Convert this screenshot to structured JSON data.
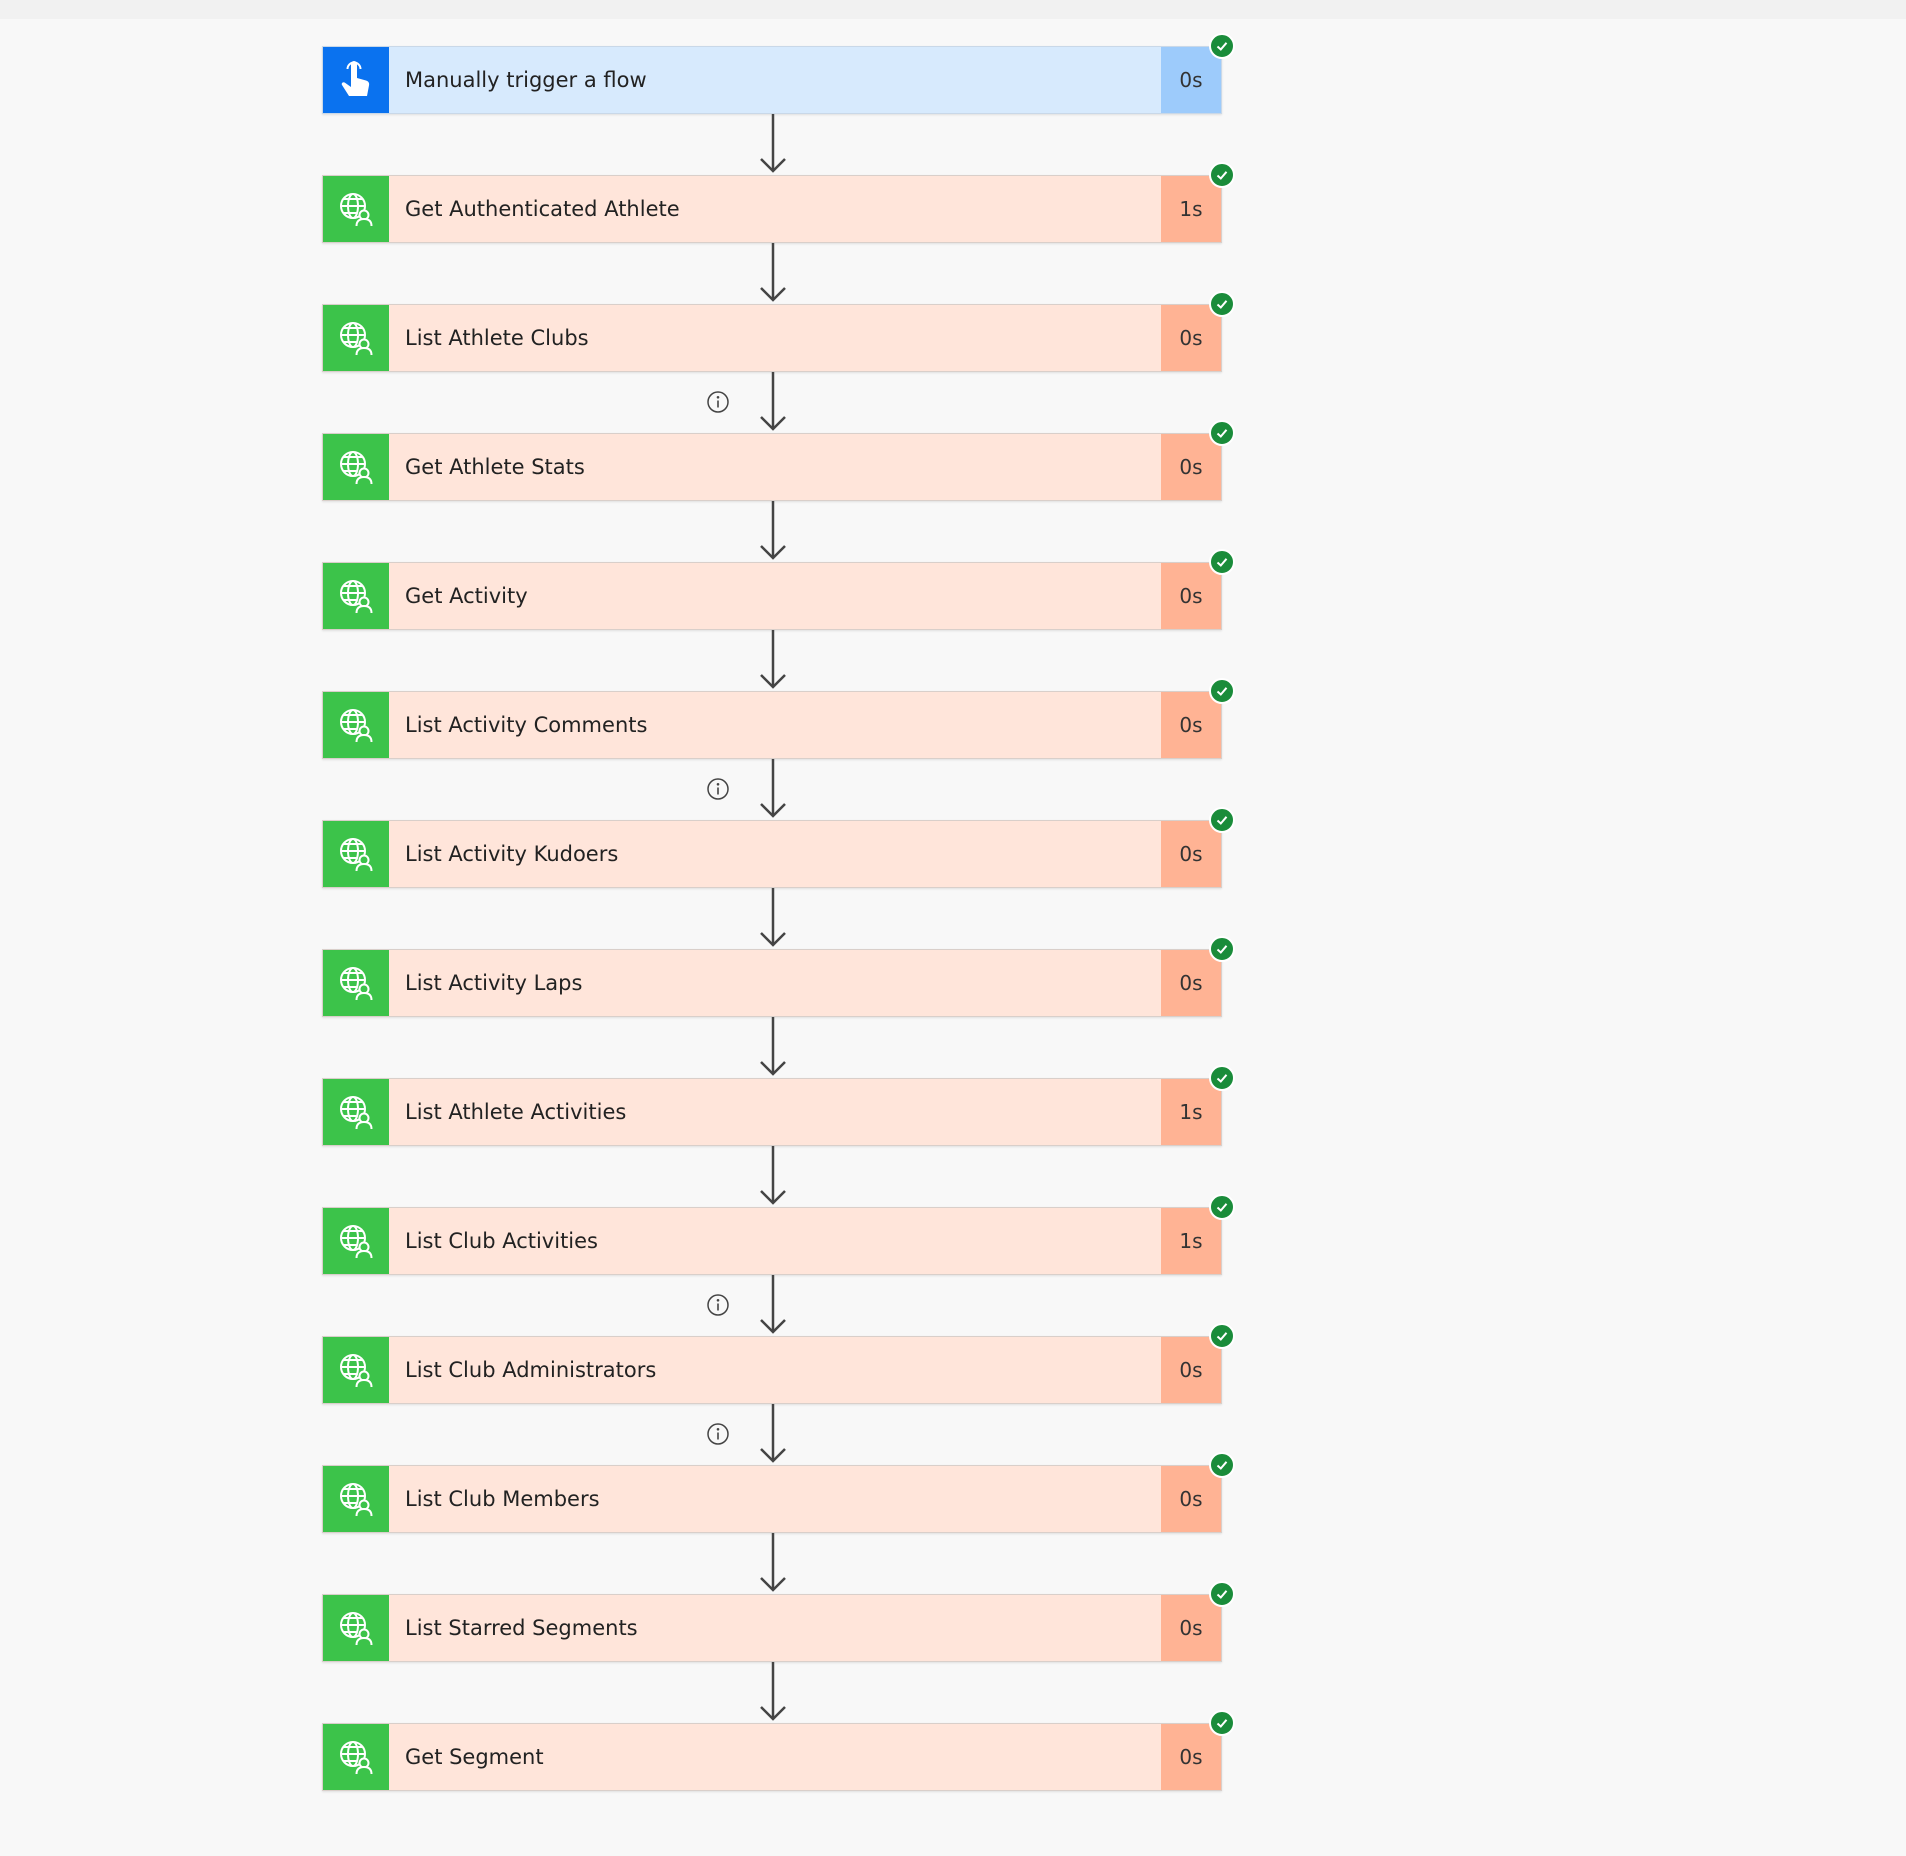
{
  "flow": {
    "steps": [
      {
        "kind": "trigger",
        "title": "Manually trigger a flow",
        "duration": "0s",
        "icon": "touch-hand-icon",
        "status": "succeeded"
      },
      {
        "kind": "action",
        "title": "Get Authenticated Athlete",
        "duration": "1s",
        "icon": "globe-person-icon",
        "status": "succeeded"
      },
      {
        "kind": "action",
        "title": "List Athlete Clubs",
        "duration": "0s",
        "icon": "globe-person-icon",
        "status": "succeeded"
      },
      {
        "kind": "action",
        "title": "Get Athlete Stats",
        "duration": "0s",
        "icon": "globe-person-icon",
        "status": "succeeded"
      },
      {
        "kind": "action",
        "title": "Get Activity",
        "duration": "0s",
        "icon": "globe-person-icon",
        "status": "succeeded"
      },
      {
        "kind": "action",
        "title": "List Activity Comments",
        "duration": "0s",
        "icon": "globe-person-icon",
        "status": "succeeded"
      },
      {
        "kind": "action",
        "title": "List Activity Kudoers",
        "duration": "0s",
        "icon": "globe-person-icon",
        "status": "succeeded"
      },
      {
        "kind": "action",
        "title": "List Activity Laps",
        "duration": "0s",
        "icon": "globe-person-icon",
        "status": "succeeded"
      },
      {
        "kind": "action",
        "title": "List Athlete Activities",
        "duration": "1s",
        "icon": "globe-person-icon",
        "status": "succeeded"
      },
      {
        "kind": "action",
        "title": "List Club Activities",
        "duration": "1s",
        "icon": "globe-person-icon",
        "status": "succeeded"
      },
      {
        "kind": "action",
        "title": "List Club Administrators",
        "duration": "0s",
        "icon": "globe-person-icon",
        "status": "succeeded"
      },
      {
        "kind": "action",
        "title": "List Club Members",
        "duration": "0s",
        "icon": "globe-person-icon",
        "status": "succeeded"
      },
      {
        "kind": "action",
        "title": "List Starred Segments",
        "duration": "0s",
        "icon": "globe-person-icon",
        "status": "succeeded"
      },
      {
        "kind": "action",
        "title": "Get Segment",
        "duration": "0s",
        "icon": "globe-person-icon",
        "status": "succeeded"
      }
    ],
    "connectors_with_info": [
      2,
      5,
      9,
      10
    ]
  },
  "colors": {
    "trigger_icon_bg": "#0a72ef",
    "trigger_card_bg": "#d7eafd",
    "trigger_duration_bg": "#9dcbfb",
    "action_icon_bg": "#3cc34a",
    "action_card_bg": "#ffe5da",
    "action_duration_bg": "#ffb394",
    "success_badge": "#1a8c3a"
  }
}
